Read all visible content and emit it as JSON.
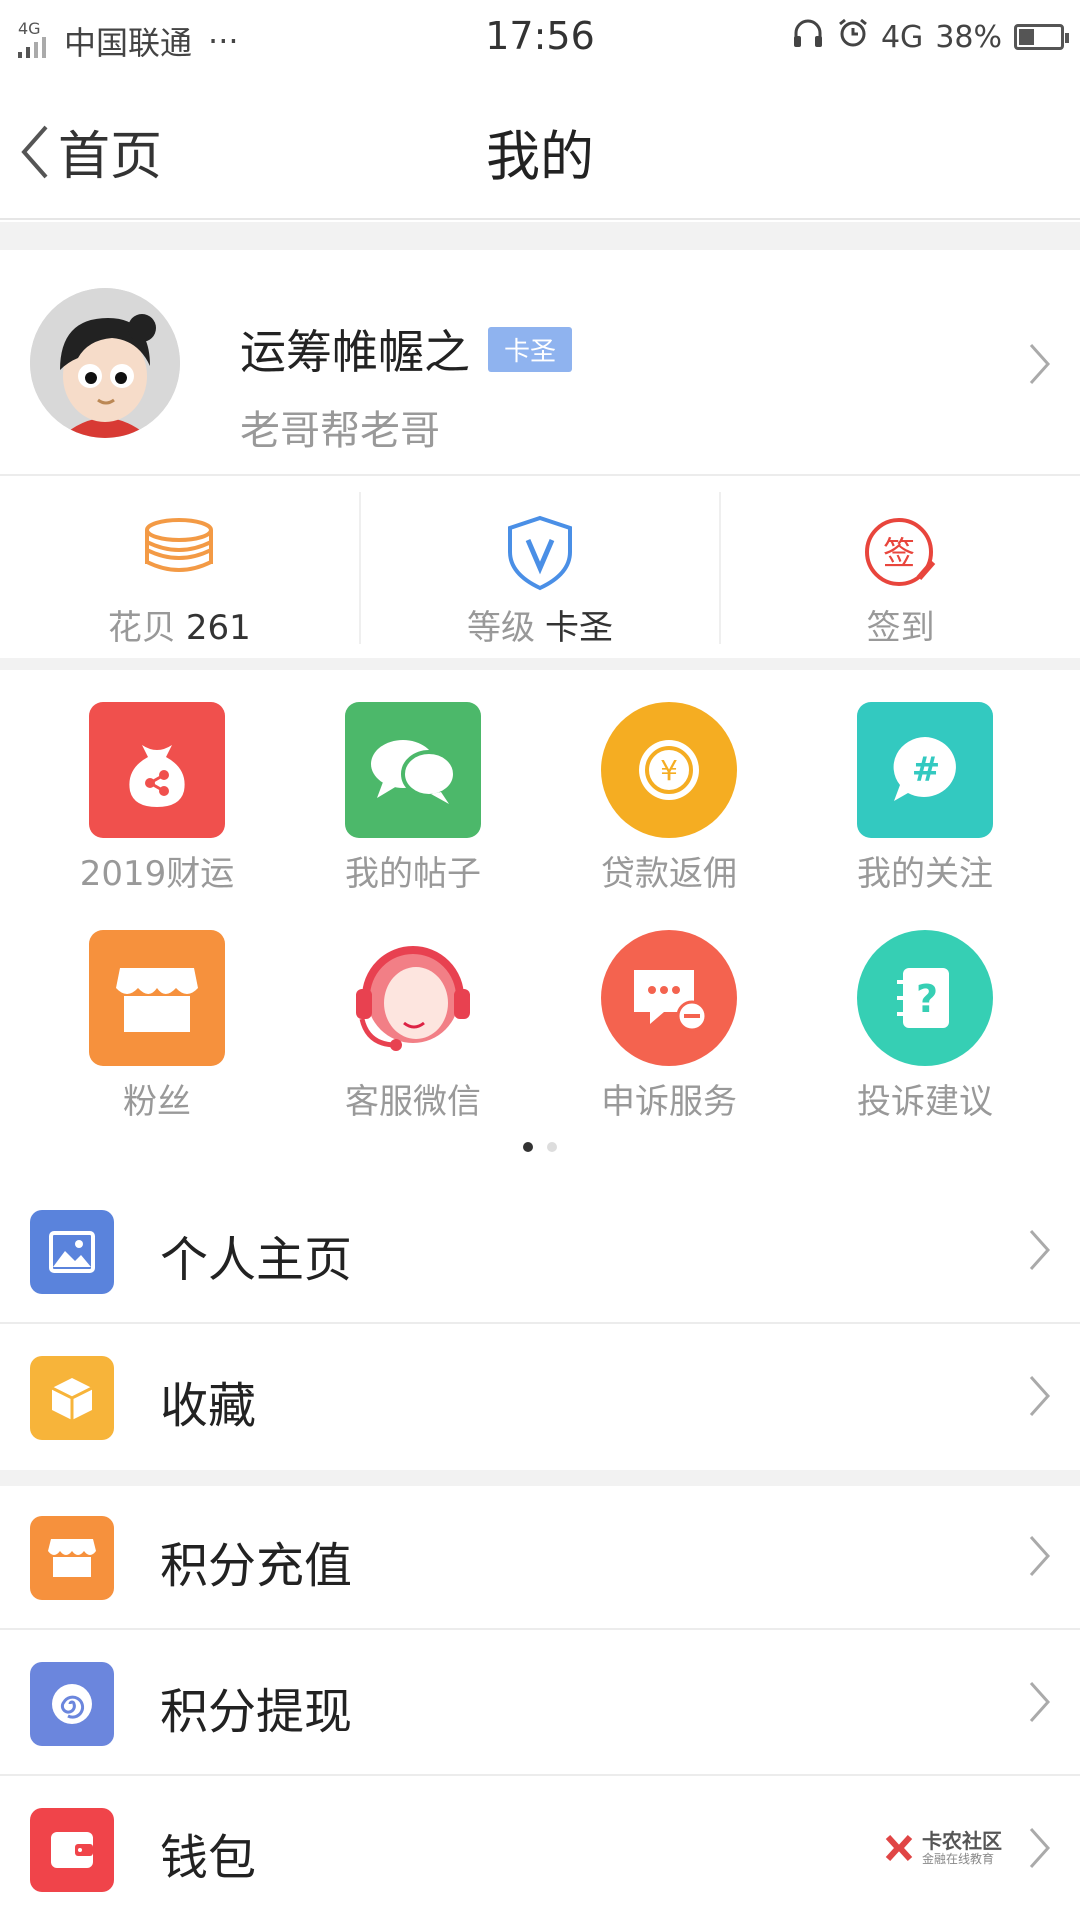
{
  "status_bar": {
    "network_tag": "4G",
    "carrier": "中国联通",
    "more": "···",
    "time": "17:56",
    "network": "4G",
    "battery": "38%",
    "battery_level": 0.38
  },
  "nav": {
    "back_label": "首页",
    "title": "我的"
  },
  "profile": {
    "name": "运筹帷幄之",
    "badge": "卡圣",
    "subtitle": "老哥帮老哥"
  },
  "stats": [
    {
      "label": "花贝",
      "value": "261",
      "icon": "coins-stack-icon",
      "color": "#f39a45"
    },
    {
      "label": "等级",
      "value": "卡圣",
      "icon": "shield-v-icon",
      "color": "#4a8fe6"
    },
    {
      "label": "签到",
      "value": "",
      "icon": "sign-in-icon",
      "color": "#e8453c"
    }
  ],
  "grid": [
    {
      "label": "2019财运",
      "icon": "fortune-bag-icon",
      "color": "#f0504d"
    },
    {
      "label": "我的帖子",
      "icon": "chat-bubbles-icon",
      "color": "#4cb86a"
    },
    {
      "label": "贷款返佣",
      "icon": "coin-yen-icon",
      "color": "#f5ad22"
    },
    {
      "label": "我的关注",
      "icon": "hashtag-bubble-icon",
      "color": "#33c9c0"
    },
    {
      "label": "粉丝",
      "icon": "storefront-icon",
      "color": "#f6913d"
    },
    {
      "label": "客服微信",
      "icon": "headset-agent-icon",
      "color": "#f27f86"
    },
    {
      "label": "申诉服务",
      "icon": "complaint-message-icon",
      "color": "#f4634f"
    },
    {
      "label": "投诉建议",
      "icon": "question-notebook-icon",
      "color": "#36cfb4"
    }
  ],
  "pager": {
    "pages": 2,
    "current": 1
  },
  "menu_section_1": [
    {
      "label": "个人主页",
      "icon": "image-icon",
      "color": "#5a83dc"
    },
    {
      "label": "收藏",
      "icon": "box-icon",
      "color": "#f7b43a"
    }
  ],
  "menu_section_2": [
    {
      "label": "积分充值",
      "icon": "storefront-icon",
      "color": "#f6913d"
    },
    {
      "label": "积分提现",
      "icon": "spiral-icon",
      "color": "#6b86dd"
    },
    {
      "label": "钱包",
      "icon": "wallet-icon",
      "color": "#f0444a"
    }
  ],
  "watermark": {
    "title": "卡农社区",
    "subtitle": "金融在线教育"
  }
}
